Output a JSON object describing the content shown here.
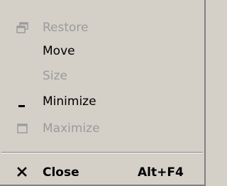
{
  "menu": {
    "items": [
      {
        "label": "Restore",
        "icon": "restore-icon",
        "enabled": false
      },
      {
        "label": "Move",
        "icon": "",
        "enabled": true
      },
      {
        "label": "Size",
        "icon": "",
        "enabled": false
      },
      {
        "label": "Minimize",
        "icon": "minimize-icon",
        "enabled": true
      },
      {
        "label": "Maximize",
        "icon": "maximize-icon",
        "enabled": false
      }
    ],
    "close": {
      "label": "Close",
      "shortcut": "Alt+F4",
      "icon": "close-icon",
      "enabled": true
    }
  }
}
